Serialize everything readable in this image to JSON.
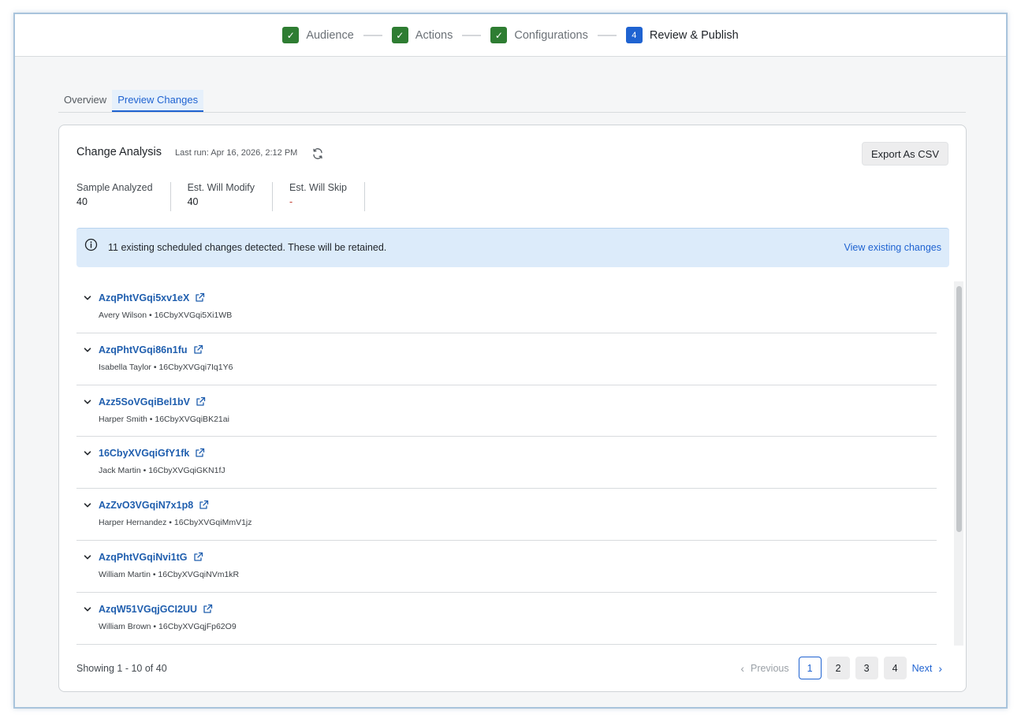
{
  "stepper": {
    "steps": [
      {
        "label": "Audience",
        "state": "done"
      },
      {
        "label": "Actions",
        "state": "done"
      },
      {
        "label": "Configurations",
        "state": "done"
      },
      {
        "label": "Review & Publish",
        "number": "4",
        "state": "current"
      }
    ]
  },
  "tabs": [
    {
      "label": "Overview",
      "active": false
    },
    {
      "label": "Preview Changes",
      "active": true
    }
  ],
  "card": {
    "title": "Change Analysis",
    "last_run": "Last run: Apr 16, 2026, 2:12 PM",
    "export_label": "Export As CSV",
    "stats": [
      {
        "label": "Sample Analyzed",
        "value": "40"
      },
      {
        "label": "Est. Will Modify",
        "value": "40"
      },
      {
        "label": "Est. Will Skip",
        "value": "-"
      }
    ],
    "banner": {
      "text": "11 existing scheduled changes detected. These will be retained.",
      "link": "View existing changes"
    },
    "items": [
      {
        "title": "AzqPhtVGqi5xv1eX",
        "subtitle": "Avery Wilson • 16CbyXVGqi5Xi1WB"
      },
      {
        "title": "AzqPhtVGqi86n1fu",
        "subtitle": "Isabella Taylor • 16CbyXVGqi7Iq1Y6"
      },
      {
        "title": "Azz5SoVGqiBel1bV",
        "subtitle": "Harper Smith • 16CbyXVGqiBK21ai"
      },
      {
        "title": "16CbyXVGqiGfY1fk",
        "subtitle": "Jack Martin • 16CbyXVGqiGKN1fJ"
      },
      {
        "title": "AzZvO3VGqiN7x1p8",
        "subtitle": "Harper Hernandez • 16CbyXVGqiMmV1jz"
      },
      {
        "title": "AzqPhtVGqiNvi1tG",
        "subtitle": "William Martin • 16CbyXVGqiNVm1kR"
      },
      {
        "title": "AzqW51VGqjGCI2UU",
        "subtitle": "William Brown • 16CbyXVGqjFp62O9"
      }
    ],
    "footer": {
      "showing": "Showing 1 - 10 of 40",
      "previous": "Previous",
      "next": "Next",
      "pages": [
        "1",
        "2",
        "3",
        "4"
      ],
      "current_page": "1"
    }
  },
  "colors": {
    "accent": "#1f63d1",
    "done": "#2e7d32",
    "banner_bg": "#dcebfa",
    "link": "#1f5eae"
  }
}
